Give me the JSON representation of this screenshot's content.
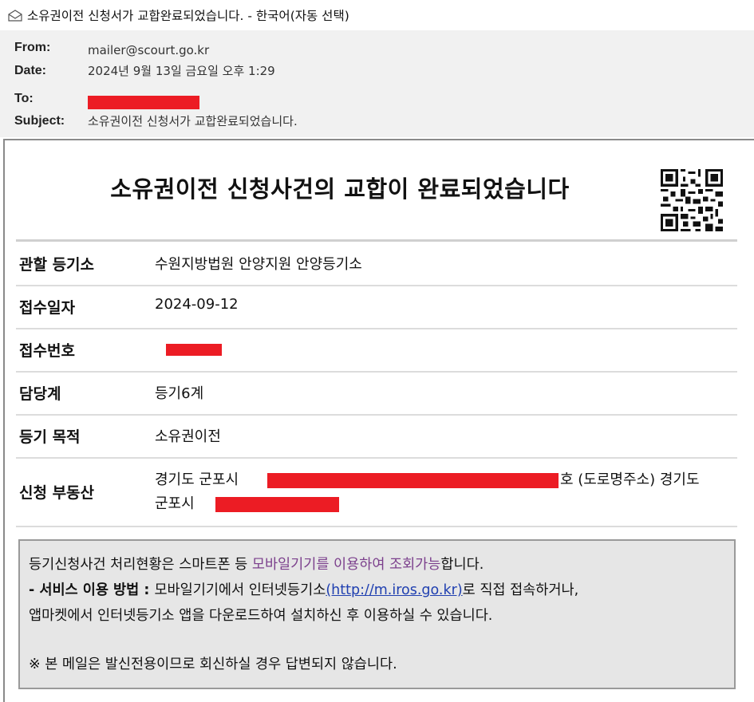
{
  "window": {
    "title": "소유권이전 신청서가 교합완료되었습니다. - 한국어(자동 선택)",
    "icon": "envelope-icon"
  },
  "header": {
    "from_label": "From:",
    "from_value": "mailer@scourt.go.kr",
    "date_label": "Date:",
    "date_value": "2024년 9월 13일 금요일 오후 1:29",
    "to_label": "To:",
    "subject_label": "Subject:",
    "subject_value": "소유권이전 신청서가 교합완료되었습니다."
  },
  "body": {
    "title": "소유권이전 신청사건의 교합이 완료되었습니다",
    "rows": [
      {
        "label": "관할 등기소",
        "value": "수원지방법원 안양지원 안양등기소"
      },
      {
        "label": "접수일자",
        "value": "2024-09-12"
      },
      {
        "label": "접수번호",
        "value": ""
      },
      {
        "label": "담당계",
        "value": "등기6계"
      },
      {
        "label": "등기 목적",
        "value": "소유권이전"
      },
      {
        "label": "신청 부동산",
        "value_line1_prefix": "경기도 군포시",
        "value_line1_suffix": "호 (도로명주소) 경기도",
        "value_line2_prefix": "군포시"
      }
    ],
    "notice": {
      "line1_a": "등기신청사건 처리현황은 스마트폰 등 ",
      "line1_b": "모바일기기를 이용하여 조회가능",
      "line1_c": "합니다.",
      "line2_bold": "- 서비스 이용 방법 : ",
      "line2_a": "모바일기기에서 인터넷등기소",
      "line2_link": "(http://m.iros.go.kr)",
      "line2_b": "로 직접 접속하거나,",
      "line3": "앱마켓에서 인터넷등기소 앱을 다운로드하여 설치하신 후 이용하실 수 있습니다.",
      "line4": "※ 본 메일은 발신전용이므로 회신하실 경우 답변되지 않습니다."
    }
  },
  "colors": {
    "redaction": "#ec1c24",
    "notice_highlight": "#7b3f8c",
    "link": "#1f3fb0"
  }
}
